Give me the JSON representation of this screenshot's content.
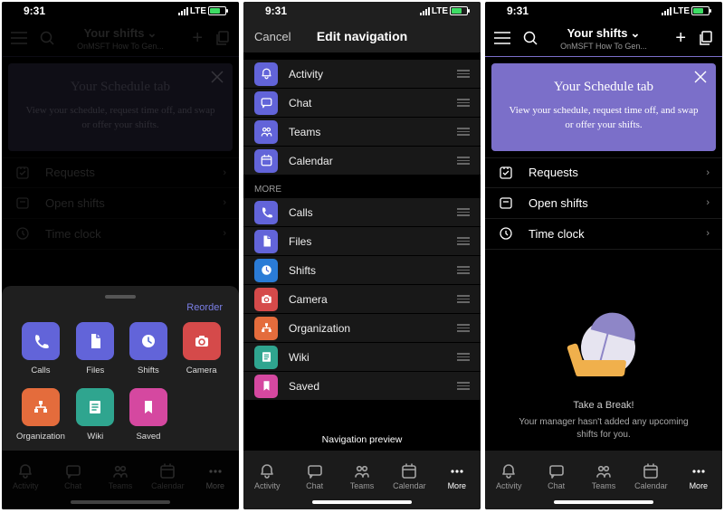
{
  "status": {
    "time": "9:31",
    "net": "LTE"
  },
  "header": {
    "title": "Your shifts",
    "subtitle": "OnMSFT How To Gen..."
  },
  "banner": {
    "title": "Your Schedule tab",
    "body": "View your schedule, request time off, and swap or offer your shifts."
  },
  "menu": [
    {
      "id": "requests",
      "label": "Requests"
    },
    {
      "id": "openshifts",
      "label": "Open shifts"
    },
    {
      "id": "timeclock",
      "label": "Time clock"
    }
  ],
  "sheet": {
    "reorder": "Reorder",
    "items": [
      {
        "id": "calls",
        "label": "Calls",
        "color": "c-purple"
      },
      {
        "id": "files",
        "label": "Files",
        "color": "c-purple"
      },
      {
        "id": "shifts",
        "label": "Shifts",
        "color": "c-purple"
      },
      {
        "id": "camera",
        "label": "Camera",
        "color": "c-red"
      },
      {
        "id": "org",
        "label": "Organization",
        "color": "c-orange"
      },
      {
        "id": "wiki",
        "label": "Wiki",
        "color": "c-teal"
      },
      {
        "id": "saved",
        "label": "Saved",
        "color": "c-pink"
      }
    ]
  },
  "editNav": {
    "cancel": "Cancel",
    "title": "Edit navigation",
    "primary": [
      {
        "id": "activity",
        "label": "Activity",
        "color": "c-purple"
      },
      {
        "id": "chat",
        "label": "Chat",
        "color": "c-purple"
      },
      {
        "id": "teams",
        "label": "Teams",
        "color": "c-purple"
      },
      {
        "id": "calendar",
        "label": "Calendar",
        "color": "c-purple"
      }
    ],
    "moreLabel": "More",
    "more": [
      {
        "id": "calls",
        "label": "Calls",
        "color": "c-purple"
      },
      {
        "id": "files",
        "label": "Files",
        "color": "c-purple"
      },
      {
        "id": "shifts",
        "label": "Shifts",
        "color": "c-blue"
      },
      {
        "id": "camera",
        "label": "Camera",
        "color": "c-red"
      },
      {
        "id": "org",
        "label": "Organization",
        "color": "c-orange"
      },
      {
        "id": "wiki",
        "label": "Wiki",
        "color": "c-teal"
      },
      {
        "id": "saved",
        "label": "Saved",
        "color": "c-pink"
      }
    ],
    "preview": "Navigation preview"
  },
  "tabs": [
    {
      "id": "activity",
      "label": "Activity"
    },
    {
      "id": "chat",
      "label": "Chat"
    },
    {
      "id": "teams",
      "label": "Teams"
    },
    {
      "id": "calendar",
      "label": "Calendar"
    },
    {
      "id": "more",
      "label": "More"
    }
  ],
  "empty": {
    "title": "Take a Break!",
    "sub": "Your manager hasn't added any upcoming shifts for you."
  }
}
